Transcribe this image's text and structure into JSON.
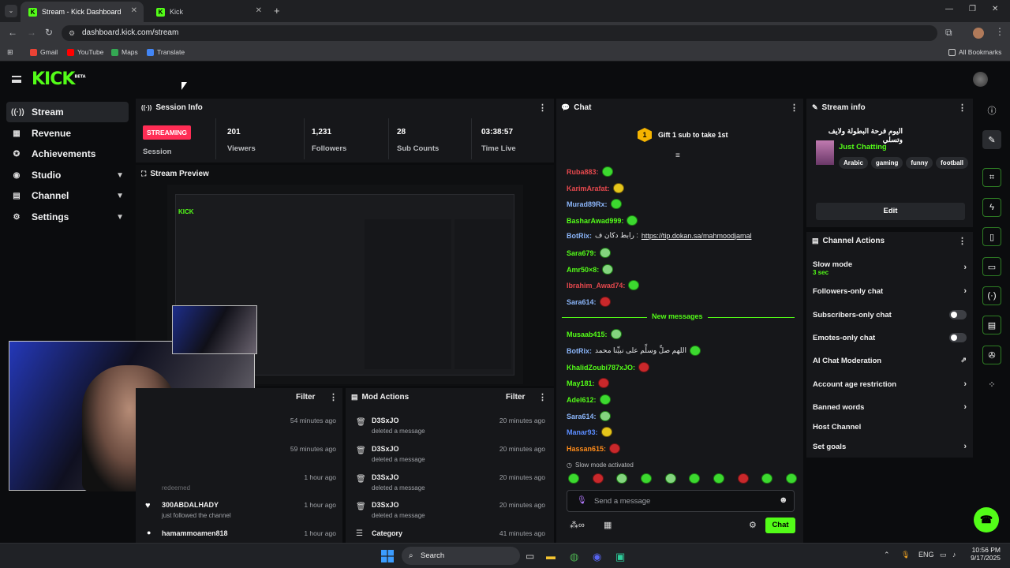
{
  "browser": {
    "tabs": [
      {
        "title": "Stream - Kick Dashboard"
      },
      {
        "title": "Kick"
      }
    ],
    "url": "dashboard.kick.com/stream",
    "bookmarks": [
      "Gmail",
      "YouTube",
      "Maps",
      "Translate"
    ],
    "all_bookmarks": "All Bookmarks"
  },
  "logo": {
    "text": "KICK",
    "beta": "BETA"
  },
  "sidebar": {
    "items": [
      {
        "label": "Stream",
        "icon": "broadcast-icon"
      },
      {
        "label": "Revenue",
        "icon": "revenue-icon"
      },
      {
        "label": "Achievements",
        "icon": "trophy-icon"
      },
      {
        "label": "Studio",
        "icon": "studio-icon"
      },
      {
        "label": "Channel",
        "icon": "channel-icon"
      },
      {
        "label": "Settings",
        "icon": "gear-icon"
      }
    ]
  },
  "session": {
    "title": "Session Info",
    "badge": "STREAMING",
    "badge_label": "Session",
    "stats": [
      {
        "value": "201",
        "label": "Viewers"
      },
      {
        "value": "1,231",
        "label": "Followers"
      },
      {
        "value": "28",
        "label": "Sub Counts"
      },
      {
        "value": "03:38:57",
        "label": "Time Live"
      }
    ]
  },
  "preview": {
    "title": "Stream Preview"
  },
  "activity": {
    "filter": "Filter",
    "items": [
      {
        "time": "54 minutes ago"
      },
      {
        "time": "59 minutes ago"
      },
      {
        "time": "1 hour ago",
        "text": "redeemed"
      },
      {
        "user": "300ABDALHADY",
        "text": "just followed the channel",
        "time": "1 hour ago"
      },
      {
        "user": "hamammoamen818",
        "time": "1 hour ago"
      }
    ]
  },
  "mod_actions": {
    "title": "Mod Actions",
    "filter": "Filter",
    "items": [
      {
        "user": "D3SxJO",
        "action": "deleted a message",
        "time": "20 minutes ago"
      },
      {
        "user": "D3SxJO",
        "action": "deleted a message",
        "time": "20 minutes ago"
      },
      {
        "user": "D3SxJO",
        "action": "deleted a message",
        "time": "20 minutes ago"
      },
      {
        "user": "D3SxJO",
        "action": "deleted a message",
        "time": "20 minutes ago"
      },
      {
        "user": "Category",
        "time": "41 minutes ago"
      }
    ]
  },
  "chat": {
    "title": "Chat",
    "gift": "Gift 1 sub to take 1st",
    "gift_count": "1",
    "messages": [
      {
        "user": "Ruba883:",
        "color": "#e5484d"
      },
      {
        "user": "KarimArafat:",
        "color": "#e5484d"
      },
      {
        "user": "Murad89Rx:",
        "color": "#8ab4f8"
      },
      {
        "user": "BasharAwad999:",
        "color": "#53fc18"
      },
      {
        "user": "BotRix:",
        "color": "#8ab4f8",
        "text": "رابط دكان ف :",
        "link": "https://tip.dokan.sa/mahmoodjamal"
      },
      {
        "user": "Sara679:",
        "color": "#53fc18"
      },
      {
        "user": "Amr50×8:",
        "color": "#53fc18"
      },
      {
        "user": "Ibrahim_Awad74:",
        "color": "#e5484d"
      },
      {
        "user": "Sara614:",
        "color": "#8ab4f8"
      },
      {
        "user": "Musaab415:",
        "color": "#53fc18"
      },
      {
        "user": "BotRix:",
        "color": "#8ab4f8",
        "text": "اللهم صلِّ وسلِّم على نبيِّنا محمد"
      },
      {
        "user": "KhalidZoubi787xJO:",
        "color": "#53fc18"
      },
      {
        "user": "May181:",
        "color": "#53fc18"
      },
      {
        "user": "Adel612:",
        "color": "#53fc18"
      },
      {
        "user": "Sara614:",
        "color": "#8ab4f8"
      },
      {
        "user": "Manar93:",
        "color": "#5b8cff"
      },
      {
        "user": "Hassan615:",
        "color": "#ff8c1a"
      }
    ],
    "new_messages": "New messages",
    "slow_mode": "Slow mode activated",
    "input_placeholder": "Send a message",
    "send": "Chat"
  },
  "stream_info": {
    "title": "Stream info",
    "stream_title": "اليوم فرحة البطولة ولايف وتسلي",
    "category": "Just Chatting",
    "tags": [
      "Arabic",
      "gaming",
      "funny",
      "football"
    ],
    "edit": "Edit"
  },
  "channel_actions": {
    "title": "Channel Actions",
    "items": [
      {
        "label": "Slow mode",
        "sub": "3 sec"
      },
      {
        "label": "Followers-only chat"
      },
      {
        "label": "Subscribers-only chat"
      },
      {
        "label": "Emotes-only chat"
      },
      {
        "label": "AI Chat Moderation"
      },
      {
        "label": "Account age restriction"
      },
      {
        "label": "Banned words"
      },
      {
        "label": "Host Channel"
      },
      {
        "label": "Set goals"
      }
    ]
  },
  "taskbar": {
    "search": "Search",
    "lang": "ENG",
    "time": "10:56 PM",
    "date": "9/17/2025"
  },
  "colors": {
    "accent": "#53fc18",
    "live": "#ff2d55"
  }
}
